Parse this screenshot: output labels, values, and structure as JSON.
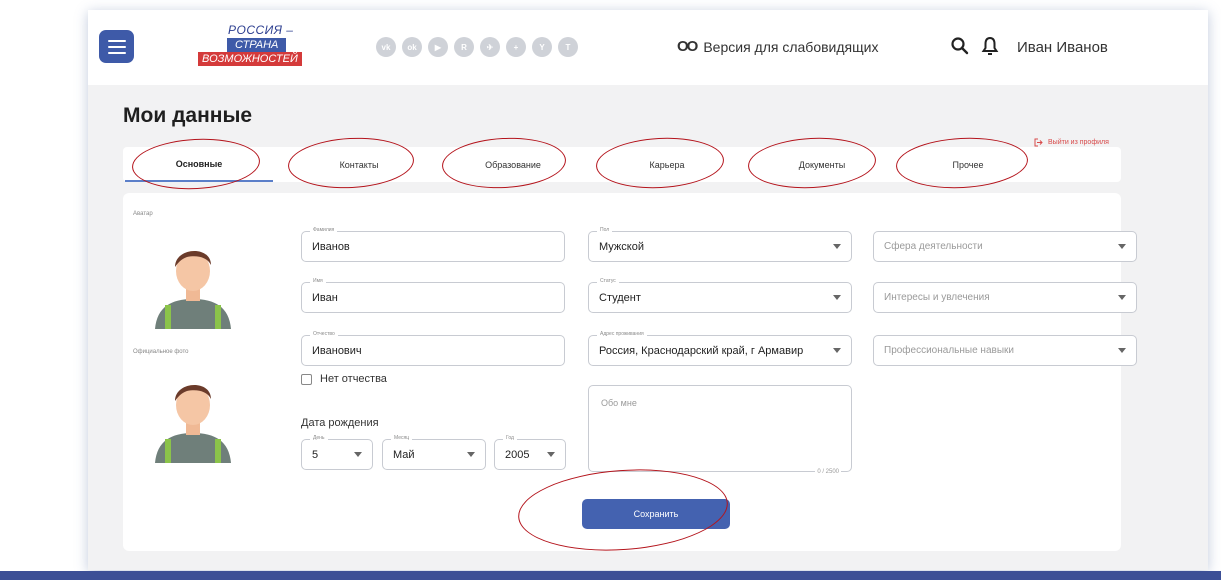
{
  "header": {
    "logo": {
      "line1": "РОССИЯ –",
      "line2": "СТРАНА",
      "line3": "ВОЗМОЖНОСТЕЙ"
    },
    "socials": [
      {
        "icon": "vk-icon",
        "glyph": "vk"
      },
      {
        "icon": "odnoklassniki-icon",
        "glyph": "ok"
      },
      {
        "icon": "youtube-icon",
        "glyph": "▶"
      },
      {
        "icon": "rutube-icon",
        "glyph": "R"
      },
      {
        "icon": "telegram-icon",
        "glyph": "✈"
      },
      {
        "icon": "plus-icon",
        "glyph": "+"
      },
      {
        "icon": "yandex-icon",
        "glyph": "Y"
      },
      {
        "icon": "tiktok-icon",
        "glyph": "T"
      }
    ],
    "vision_glyph": "OO",
    "vision_label": "Версия для слабовидящих",
    "user_name": "Иван Иванов"
  },
  "page": {
    "title": "Мои данные",
    "logout_label": "Выйти из профиля"
  },
  "tabs": [
    {
      "label": "Основные",
      "active": true
    },
    {
      "label": "Контакты",
      "active": false
    },
    {
      "label": "Образование",
      "active": false
    },
    {
      "label": "Карьера",
      "active": false
    },
    {
      "label": "Документы",
      "active": false
    },
    {
      "label": "Прочее",
      "active": false
    }
  ],
  "form": {
    "avatar_label": "Аватар",
    "official_photo_label": "Официальное фото",
    "surname": {
      "label": "Фамилия",
      "value": "Иванов"
    },
    "name": {
      "label": "Имя",
      "value": "Иван"
    },
    "patronymic": {
      "label": "Отчество",
      "value": "Иванович"
    },
    "no_patronymic_label": "Нет отчества",
    "no_patronymic_checked": false,
    "dob_label": "Дата рождения",
    "day": {
      "label": "День",
      "value": "5"
    },
    "month": {
      "label": "Месяц",
      "value": "Май"
    },
    "year": {
      "label": "Год",
      "value": "2005"
    },
    "gender": {
      "label": "Пол",
      "value": "Мужской"
    },
    "status": {
      "label": "Статус",
      "value": "Студент"
    },
    "address": {
      "label": "Адрес проживания",
      "value": "Россия, Краснодарский край, г Армавир"
    },
    "about": {
      "placeholder": "Обо мне",
      "counter": "0 / 2500"
    },
    "sphere": {
      "placeholder": "Сфера деятельности"
    },
    "interests": {
      "placeholder": "Интересы и увлечения"
    },
    "skills": {
      "placeholder": "Профессиональные навыки"
    },
    "save_label": "Сохранить"
  },
  "colors": {
    "primary": "#4462b0",
    "accent_red": "#d84a4a",
    "annotation": "#b4141c"
  }
}
